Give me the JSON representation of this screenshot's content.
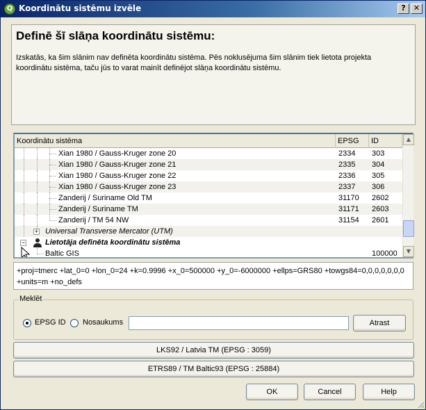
{
  "window": {
    "title": "Koordinātu sistēmu izvēle",
    "help_glyph": "?",
    "close_glyph": "✕",
    "app_icon_letter": "Q"
  },
  "info": {
    "heading": "Definē šī slāņa koordinātu sistēmu:",
    "body": "Izskatās, ka šim slānim nav definēta koordinātu sistēma. Pēs noklusējuma šim slānim tiek lietota projekta koordinātu sistēma, taču jūs to varat mainīt definējot slāņa koordinātu sistēmu."
  },
  "tree": {
    "columns": {
      "name": "Koordinātu sistēma",
      "epsg": "EPSG",
      "id": "ID"
    },
    "rows": [
      {
        "name": "Xian 1980 / Gauss-Kruger zone 20",
        "epsg": "2334",
        "id": "303"
      },
      {
        "name": "Xian 1980 / Gauss-Kruger zone 21",
        "epsg": "2335",
        "id": "304"
      },
      {
        "name": "Xian 1980 / Gauss-Kruger zone 22",
        "epsg": "2336",
        "id": "305"
      },
      {
        "name": "Xian 1980 / Gauss-Kruger zone 23",
        "epsg": "2337",
        "id": "306"
      },
      {
        "name": "Zanderij / Suriname Old TM",
        "epsg": "31170",
        "id": "2602"
      },
      {
        "name": "Zanderij / Suriname TM",
        "epsg": "31171",
        "id": "2603"
      },
      {
        "name": "Zanderij / TM 54 NW",
        "epsg": "31154",
        "id": "2601"
      }
    ],
    "utm_group": "Universal Transverse Mercator (UTM)",
    "user_group": "Lietotāja definēta koordinātu sistēma",
    "user_row": {
      "name": "Baltic GIS",
      "epsg": "",
      "id": "100000"
    },
    "expand_glyph": "+",
    "collapse_glyph": "−"
  },
  "proj_string": "+proj=tmerc +lat_0=0 +lon_0=24 +k=0.9996 +x_0=500000 +y_0=-6000000 +ellps=GRS80 +towgs84=0,0,0,0,0,0,0 +units=m +no_defs",
  "search": {
    "legend": "Meklēt",
    "epsg_label": "EPSG ID",
    "name_label": "Nosaukums",
    "selected": "EPSG ID",
    "input_value": "",
    "find_label": "Atrast"
  },
  "recent": [
    "LKS92 / Latvia TM (EPSG : 3059)",
    "ETRS89 / TM Baltic93 (EPSG : 25884)"
  ],
  "buttons": {
    "ok": "OK",
    "cancel": "Cancel",
    "help": "Help"
  }
}
